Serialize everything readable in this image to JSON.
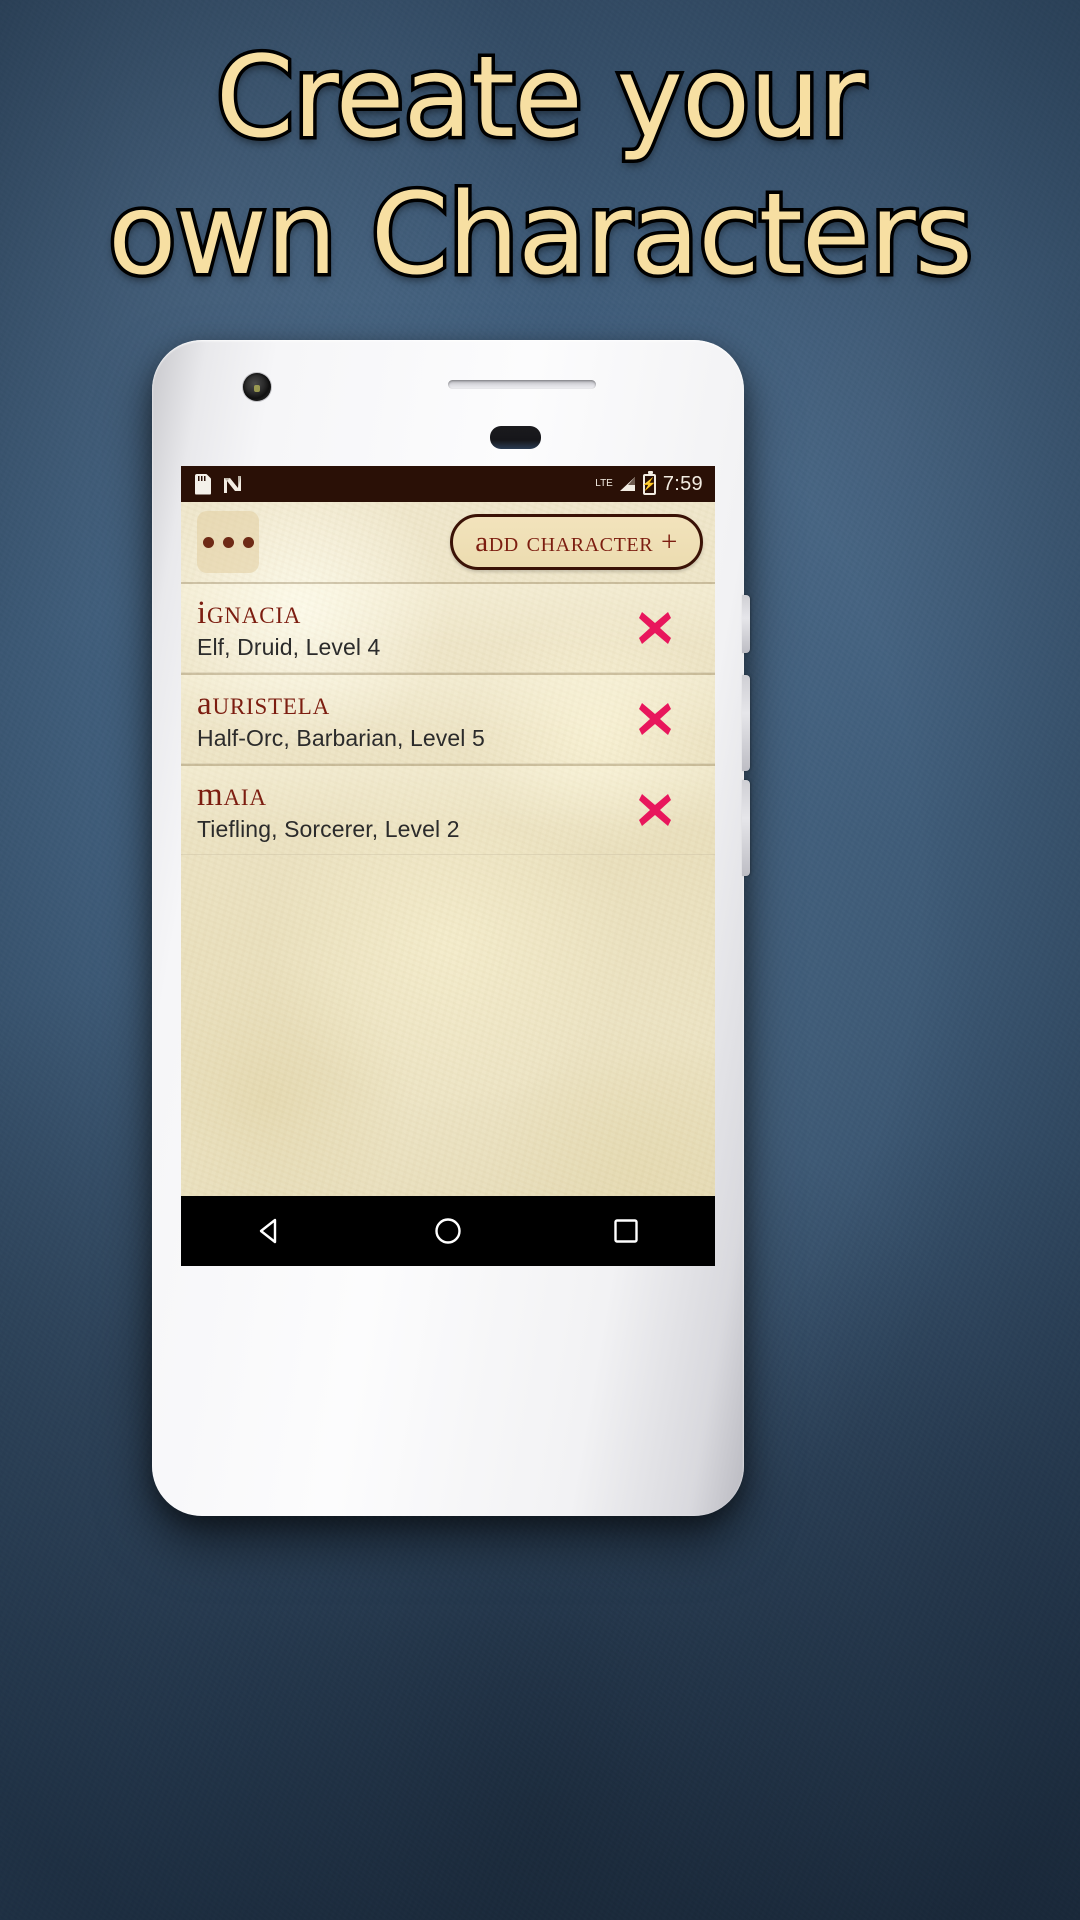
{
  "promo": {
    "headline_lines": [
      "Create your",
      "own Characters"
    ],
    "headline_color": "#f7dfa2",
    "background_color": "#3d5a77"
  },
  "phone": {
    "hardware": {
      "camera": "front-camera",
      "earpiece": "earpiece-speaker",
      "sensor": "proximity-sensor"
    }
  },
  "statusbar": {
    "background_color": "#2a1006",
    "icons_left": [
      "sd-card-icon",
      "android-nougat-icon"
    ],
    "network_label": "LTE",
    "icons_right": [
      "signal-bars-icon",
      "battery-charging-icon"
    ],
    "time": "7:59"
  },
  "app": {
    "background_color": "#ece3c4",
    "menu_button": {
      "label": "overflow-menu",
      "dots": 3
    },
    "add_character_button": {
      "label": "Add Character +",
      "text_color": "#7c1d10",
      "border_color": "#3a1206"
    },
    "list": {
      "delete_icon_color": "#e8165c",
      "name_color": "#7c1d10",
      "subtitle_color": "#2b2b2b",
      "characters": [
        {
          "name": "Ignacia",
          "subtitle": "Elf, Druid, Level 4",
          "race": "Elf",
          "class": "Druid",
          "level": 4,
          "delete_label": "delete-character"
        },
        {
          "name": "Auristela",
          "subtitle": "Half-Orc, Barbarian, Level 5",
          "race": "Half-Orc",
          "class": "Barbarian",
          "level": 5,
          "delete_label": "delete-character"
        },
        {
          "name": "Maia",
          "subtitle": "Tiefling, Sorcerer, Level 2",
          "race": "Tiefling",
          "class": "Sorcerer",
          "level": 2,
          "delete_label": "delete-character"
        }
      ]
    }
  },
  "navbar": {
    "background_color": "#000000",
    "buttons": [
      "back-icon",
      "home-icon",
      "recents-icon"
    ]
  }
}
